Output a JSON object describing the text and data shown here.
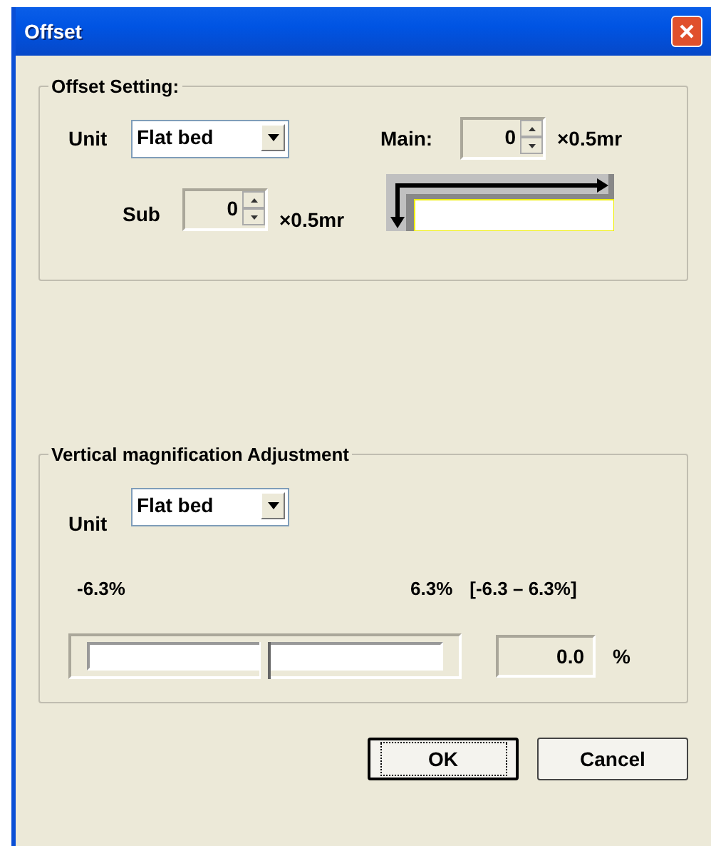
{
  "window": {
    "title": "Offset"
  },
  "offset_setting": {
    "title": "Offset Setting:",
    "unit": {
      "label": "Unit",
      "value": "Flat bed"
    },
    "main": {
      "label": "Main:",
      "value": "0",
      "suffix": "×0.5mr"
    },
    "sub": {
      "label": "Sub",
      "value": "0",
      "suffix": "×0.5mr"
    }
  },
  "vertical_magnification": {
    "title": "Vertical magnification Adjustment",
    "unit": {
      "label": "Unit",
      "value": "Flat bed"
    },
    "min_label": "-6.3%",
    "max_label": "6.3%",
    "range": "[-6.3 – 6.3%]",
    "slider": {
      "level": 0.5
    },
    "value": "0.0",
    "value_unit": "%"
  },
  "buttons": [
    {
      "label": "OK",
      "default": true
    },
    {
      "label": "Cancel",
      "default": false
    }
  ]
}
